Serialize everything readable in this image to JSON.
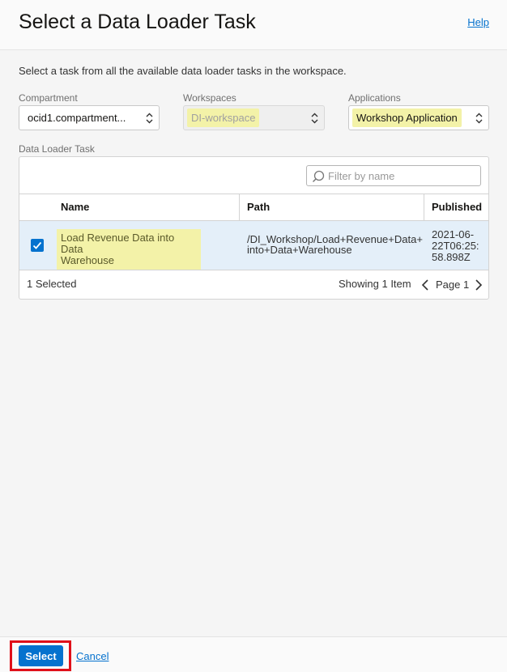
{
  "dialog": {
    "title": "Select a Data Loader Task",
    "help_label": "Help",
    "intro": "Select a task from all the available data loader tasks in the workspace."
  },
  "filters": {
    "compartment": {
      "label": "Compartment",
      "value": "ocid1.compartment..."
    },
    "workspaces": {
      "label": "Workspaces",
      "value": "DI-workspace"
    },
    "applications": {
      "label": "Applications",
      "value": "Workshop Application"
    }
  },
  "table": {
    "section_label": "Data Loader Task",
    "filter_placeholder": "Filter by name",
    "columns": [
      "Name",
      "Path",
      "Published"
    ],
    "rows": [
      {
        "checked": true,
        "name_line1": "Load Revenue Data into Data",
        "name_line2": "Warehouse",
        "path_line1": "/DI_Workshop/Load+Revenue+Data+",
        "path_line2": "into+Data+Warehouse",
        "published_line1": "2021-06-",
        "published_line2": "22T06:25:",
        "published_line3": "58.898Z"
      }
    ],
    "selected_count": "1 Selected",
    "showing": "Showing 1 Item",
    "page": "Page 1"
  },
  "actions": {
    "select_label": "Select",
    "cancel_label": "Cancel"
  },
  "colors": {
    "accent": "#0572ce",
    "highlight": "#f3f2a8",
    "selected_row": "#e4eff9",
    "callout_border": "#e0101a"
  }
}
